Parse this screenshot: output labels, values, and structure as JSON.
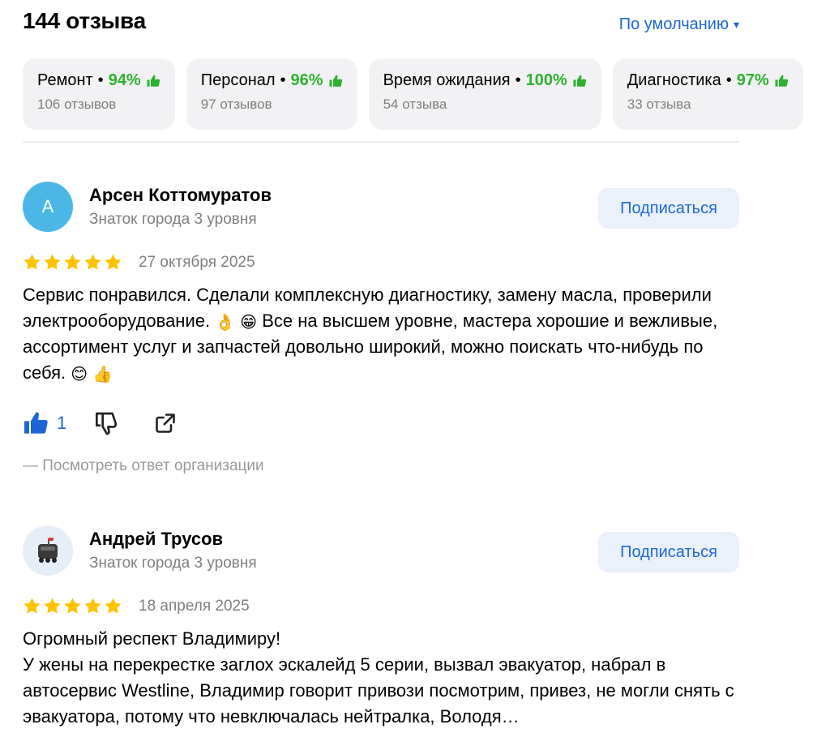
{
  "header": {
    "count_title": "144 отзыва",
    "sort_label": "По умолчанию",
    "sort_caret": "▾"
  },
  "aspects": [
    {
      "name": "Ремонт",
      "percent": "94%",
      "count": "106 отзывов"
    },
    {
      "name": "Персонал",
      "percent": "96%",
      "count": "97 отзывов"
    },
    {
      "name": "Время ожидания",
      "percent": "100%",
      "count": "54 отзыва"
    },
    {
      "name": "Диагностика",
      "percent": "97%",
      "count": "33 отзыва"
    }
  ],
  "reviews": [
    {
      "avatar_letter": "А",
      "author": "Арсен Коттомуратов",
      "level": "Знаток города 3 уровня",
      "subscribe_label": "Подписаться",
      "stars": 5,
      "date": "27 октября 2025",
      "text_parts": [
        "Сервис понравился. Сделали комплексную диагностику, замену масла, проверили электрооборудование.",
        "Все на высшем уровне, мастера хорошие и вежливые, ассортимент услуг и запчастей довольно широкий, можно поискать что-нибудь по себя."
      ],
      "emoji_ok": "👌",
      "emoji_grin": "😁",
      "emoji_smile": "😊",
      "emoji_thumb": "👍",
      "likes": "1",
      "answer_link": "— Посмотреть ответ организации"
    },
    {
      "author": "Андрей Трусов",
      "level": "Знаток города 3 уровня",
      "subscribe_label": "Подписаться",
      "stars": 5,
      "date": "18 апреля 2025",
      "text_line1": "Огромный респект Владимиру!",
      "text_line2": "У жены на перекрестке заглох эскалейд 5 серии, вызвал эвакуатор, набрал в автосервис Westline, Владимир говорит привози посмотрим, привез, не могли снять с эвакуатора, потому что невключалась нейтралка, Володя…"
    }
  ],
  "colors": {
    "accent": "#1e66d6",
    "positive": "#2cb22c",
    "star": "#fdc300",
    "muted": "#7f7f7f"
  }
}
